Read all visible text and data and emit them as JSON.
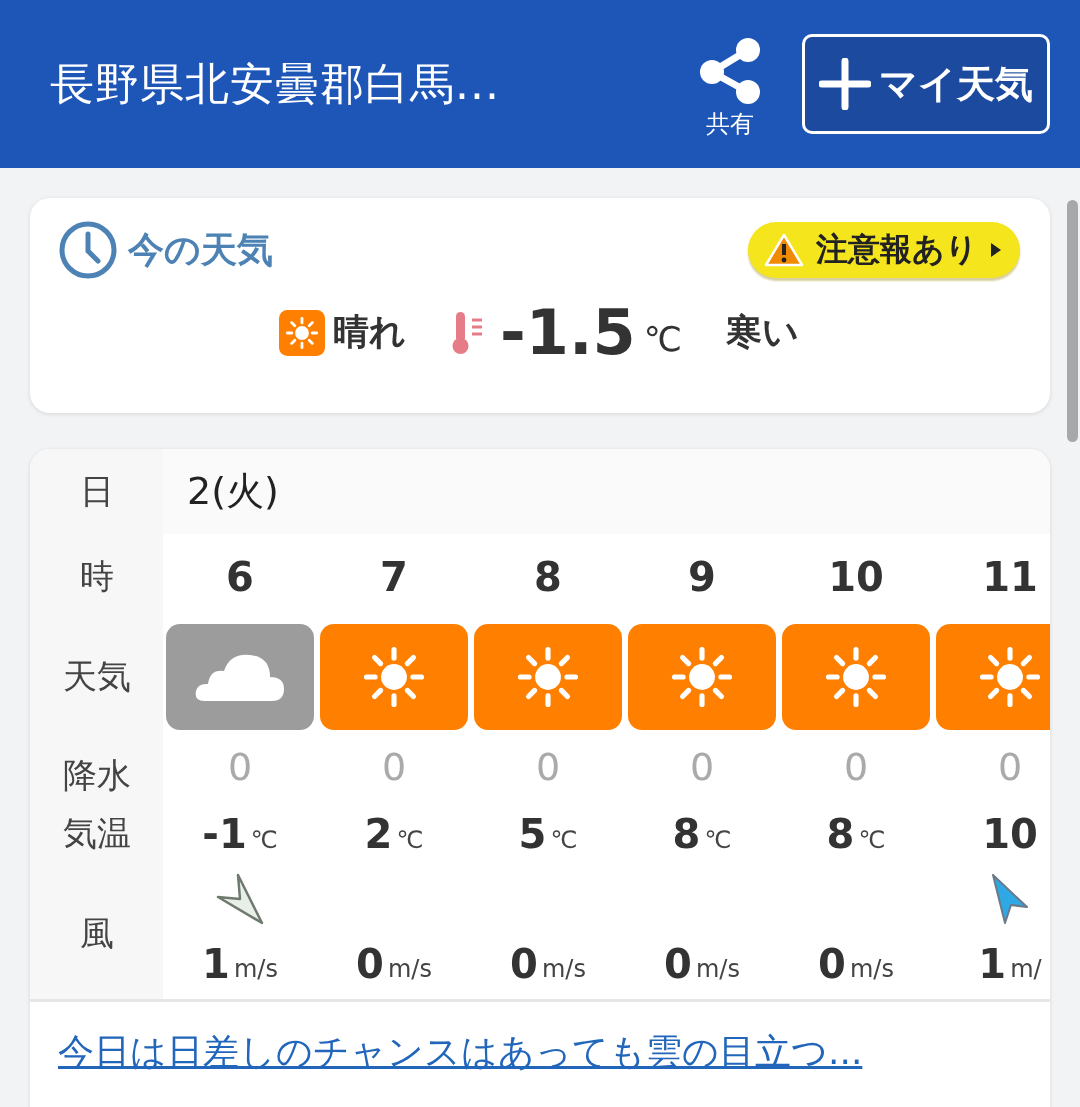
{
  "header": {
    "title": "長野県北安曇郡白馬...",
    "share_label": "共有",
    "my_weather_button": "マイ天気"
  },
  "current": {
    "title": "今の天気",
    "alert": "注意報あり",
    "weather": "晴れ",
    "weather_icon": {
      "kind": "sunny"
    },
    "temperature": "-1.5",
    "unit": "℃",
    "feeling": "寒い"
  },
  "forecast": {
    "row_labels": {
      "date": "日",
      "hour": "時",
      "weather": "天気",
      "precip": "降水",
      "temp": "気温",
      "wind": "風"
    },
    "date": "2(火)",
    "hours": [
      {
        "hour": "6",
        "weather_icon": {
          "kind": "cloudy"
        },
        "precip": "0",
        "temp": "-1",
        "temp_unit": "℃",
        "wind_icon": {
          "kind": "light"
        },
        "wind_speed": "1",
        "wind_unit": "m/s"
      },
      {
        "hour": "7",
        "weather_icon": {
          "kind": "sunny"
        },
        "precip": "0",
        "temp": "2",
        "temp_unit": "℃",
        "wind_speed": "0",
        "wind_unit": "m/s"
      },
      {
        "hour": "8",
        "weather_icon": {
          "kind": "sunny"
        },
        "precip": "0",
        "temp": "5",
        "temp_unit": "℃",
        "wind_speed": "0",
        "wind_unit": "m/s"
      },
      {
        "hour": "9",
        "weather_icon": {
          "kind": "sunny"
        },
        "precip": "0",
        "temp": "8",
        "temp_unit": "℃",
        "wind_speed": "0",
        "wind_unit": "m/s"
      },
      {
        "hour": "10",
        "weather_icon": {
          "kind": "sunny"
        },
        "precip": "0",
        "temp": "8",
        "temp_unit": "℃",
        "wind_speed": "0",
        "wind_unit": "m/s"
      },
      {
        "hour": "11",
        "weather_icon": {
          "kind": "sunny"
        },
        "precip": "0",
        "temp": "10",
        "wind_icon": {
          "kind": "moderate"
        },
        "wind_speed": "1",
        "wind_unit": "m/"
      }
    ]
  },
  "summary_link": "今日は日差しのチャンスはあっても雲の目立つ..."
}
